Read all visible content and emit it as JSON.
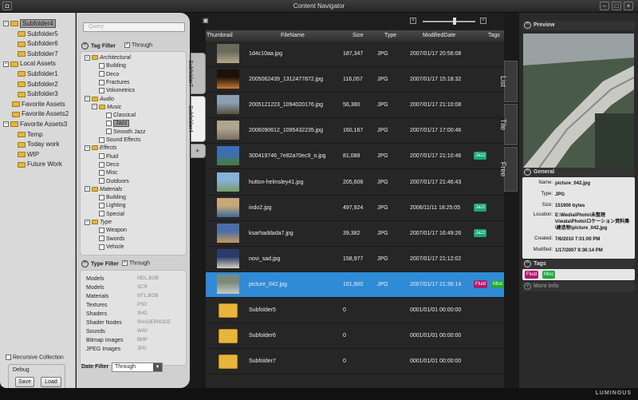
{
  "window": {
    "title": "Content Navigator"
  },
  "tree": [
    {
      "label": "Subfolder4",
      "toggle": "−"
    },
    {
      "label": "Subfolder5"
    },
    {
      "label": "Subfolder6"
    },
    {
      "label": "Subfolder7"
    },
    {
      "label": "Local Assets",
      "toggle": "−"
    },
    {
      "label": "Subfolder1"
    },
    {
      "label": "Subfolder2"
    },
    {
      "label": "Subfolder3"
    },
    {
      "label": "Favorite Assets"
    },
    {
      "label": "Favorite Assets2"
    },
    {
      "label": "Favorite Assets3",
      "toggle": "−"
    },
    {
      "label": "Temp"
    },
    {
      "label": "Today work"
    },
    {
      "label": "WIP"
    },
    {
      "label": "Future Work"
    }
  ],
  "left_bottom": {
    "recursive": "Recursive Collection",
    "debug": "Debug",
    "save": "Save",
    "load": "Load"
  },
  "filter": {
    "search_placeholder": "Query",
    "tag_filter": "Tag Filter",
    "through": "Through",
    "tags": [
      {
        "label": "Architectural",
        "group": true,
        "toggle": "−"
      },
      {
        "label": "Building"
      },
      {
        "label": "Deco"
      },
      {
        "label": "Fractures"
      },
      {
        "label": "Volumetrics"
      },
      {
        "label": "Audio",
        "group": true,
        "toggle": "−"
      },
      {
        "label": "Music",
        "group": true,
        "toggle": "−"
      },
      {
        "label": "Classical"
      },
      {
        "label": "Jazz"
      },
      {
        "label": "Smooth Jazz"
      },
      {
        "label": "Sound Effects"
      },
      {
        "label": "Effects",
        "group": true,
        "toggle": "−"
      },
      {
        "label": "Fluid"
      },
      {
        "label": "Deco"
      },
      {
        "label": "Misc"
      },
      {
        "label": "Outdoors"
      },
      {
        "label": "Materials",
        "group": true,
        "toggle": "−"
      },
      {
        "label": "Building"
      },
      {
        "label": "Lighting"
      },
      {
        "label": "Special"
      },
      {
        "label": "Type",
        "group": true,
        "toggle": "−"
      },
      {
        "label": "Weapon"
      },
      {
        "label": "Swords"
      },
      {
        "label": "Vehicle"
      }
    ],
    "type_filter": "Type Filter",
    "type_through": "Through",
    "types": [
      {
        "label": "Models",
        "ext": "MDL.BOB"
      },
      {
        "label": "Models",
        "ext": "SCR"
      },
      {
        "label": "Materials",
        "ext": "MTL.BOB"
      },
      {
        "label": "Textures",
        "ext": "PSD"
      },
      {
        "label": "Shaders",
        "ext": "SHD"
      },
      {
        "label": "Shader Nodes",
        "ext": "SHADERNODE"
      },
      {
        "label": "Sounds",
        "ext": "WAV"
      },
      {
        "label": "Bitmap Images",
        "ext": "BMP"
      },
      {
        "label": "JPEG Images",
        "ext": "JPG"
      }
    ],
    "date_filter": "Date Filter",
    "date_value": "Through"
  },
  "side_tabs": [
    "Subfolder7",
    "Subfolder4",
    "+"
  ],
  "columns": {
    "thumbnail": "Thumbnail",
    "filename": "FileName",
    "size": "Size",
    "type": "Type",
    "modified": "ModifiedDate",
    "tags": "Tags"
  },
  "files": [
    {
      "name": "1d4c10aa.jpg",
      "size": "187,347",
      "type": "JPG",
      "date": "2007/01/17 20:56:08",
      "tags": []
    },
    {
      "name": "2005062439_1312477872.jpg",
      "size": "116,057",
      "type": "JPG",
      "date": "2007/01/17 15:18:32",
      "tags": []
    },
    {
      "name": "2005121223_1094020176.jpg",
      "size": "56,380",
      "type": "JPG",
      "date": "2007/01/17 21:10:08",
      "tags": []
    },
    {
      "name": "2006090612_1095432235.jpg",
      "size": "160,167",
      "type": "JPG",
      "date": "2007/01/17 17:00:46",
      "tags": []
    },
    {
      "name": "300419746_7e82a70ec9_o.jpg",
      "size": "81,088",
      "type": "JPG",
      "date": "2007/01/17 21:10:46",
      "tags": [
        "Jazz"
      ]
    },
    {
      "name": "hutton-helmsley41.jpg",
      "size": "205,608",
      "type": "JPG",
      "date": "2007/01/17 21:46:43",
      "tags": []
    },
    {
      "name": "indo2.jpg",
      "size": "497,924",
      "type": "JPG",
      "date": "2006/11/11 18:25:05",
      "tags": [
        "Jazz"
      ]
    },
    {
      "name": "ksarhaddada7.jpg",
      "size": "39,382",
      "type": "JPG",
      "date": "2007/01/17 16:49:26",
      "tags": [
        "Jazz"
      ]
    },
    {
      "name": "novi_sad.jpg",
      "size": "158,977",
      "type": "JPG",
      "date": "2007/01/17 21:12:02",
      "tags": []
    },
    {
      "name": "picture_042.jpg",
      "size": "151,900",
      "type": "JPG",
      "date": "2007/01/17 21:36:14",
      "tags": [
        "Fluid",
        "Misc"
      ],
      "selected": true
    },
    {
      "name": "Subfolder5",
      "size": "0",
      "type": "",
      "date": "0001/01/01 00:00:00",
      "tags": [],
      "folder": true
    },
    {
      "name": "Subfolder6",
      "size": "0",
      "type": "",
      "date": "0001/01/01 00:00:00",
      "tags": [],
      "folder": true
    },
    {
      "name": "Subfolder7",
      "size": "0",
      "type": "",
      "date": "0001/01/01 00:00:00",
      "tags": [],
      "folder": true
    }
  ],
  "view_tabs": [
    "List",
    "Tile",
    "Free"
  ],
  "preview": {
    "title": "Preview",
    "general_title": "General",
    "fields": [
      {
        "k": "Name:",
        "v": "picture_042.jpg"
      },
      {
        "k": "Type:",
        "v": "JPG"
      },
      {
        "k": "Size:",
        "v": "151900 bytes"
      },
      {
        "k": "Location:",
        "v": "E:\\Media\\Photo\\未整理\\riwata\\Photo\\ロケーション資料集\\建造物\\picture_042.jpg"
      },
      {
        "k": "Created:",
        "v": "7/6/2010 7:01:00 PM"
      },
      {
        "k": "Modified:",
        "v": "1/17/2007 9:36:14 PM"
      }
    ],
    "tags_title": "Tags",
    "tags": [
      "Fluid",
      "Misc"
    ],
    "more_info": "More Info"
  },
  "footer": {
    "brand": "LUMINOUS"
  }
}
